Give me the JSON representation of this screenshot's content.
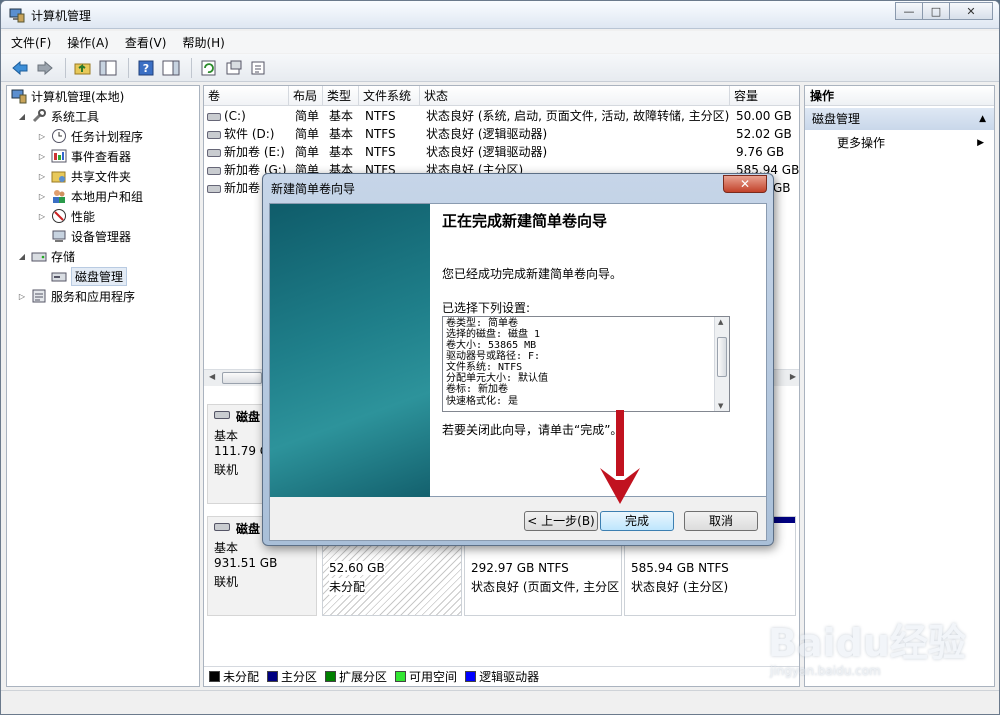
{
  "window": {
    "title": "计算机管理",
    "controls": {
      "minimize": "—",
      "maximize": "□",
      "close": "✕"
    }
  },
  "menu": [
    "文件(F)",
    "操作(A)",
    "查看(V)",
    "帮助(H)"
  ],
  "toolbar": {
    "icons": [
      "back-icon",
      "forward-icon",
      "up-folder-icon",
      "show-hide-tree-icon",
      "help-icon",
      "show-pane-icon",
      "refresh-icon",
      "properties-icon",
      "export-icon"
    ]
  },
  "tree": {
    "root": "计算机管理(本地)",
    "system_tools": "系统工具",
    "task_scheduler": "任务计划程序",
    "event_viewer": "事件查看器",
    "shared_folders": "共享文件夹",
    "local_users": "本地用户和组",
    "performance": "性能",
    "device_manager": "设备管理器",
    "storage": "存储",
    "disk_management": "磁盘管理",
    "services": "服务和应用程序"
  },
  "volumes": {
    "headers": [
      "卷",
      "布局",
      "类型",
      "文件系统",
      "状态",
      "容量"
    ],
    "rows": [
      {
        "name": "(C:)",
        "layout": "简单",
        "type": "基本",
        "fs": "NTFS",
        "status": "状态良好 (系统, 启动, 页面文件, 活动, 故障转储, 主分区)",
        "capacity": "50.00 GB"
      },
      {
        "name": "软件 (D:)",
        "layout": "简单",
        "type": "基本",
        "fs": "NTFS",
        "status": "状态良好 (逻辑驱动器)",
        "capacity": "52.02 GB"
      },
      {
        "name": "新加卷 (E:)",
        "layout": "简单",
        "type": "基本",
        "fs": "NTFS",
        "status": "状态良好 (逻辑驱动器)",
        "capacity": "9.76 GB"
      },
      {
        "name": "新加卷 (G:)",
        "layout": "简单",
        "type": "基本",
        "fs": "NTFS",
        "status": "状态良好 (主分区)",
        "capacity": "585.94 GB"
      },
      {
        "name": "新加卷",
        "layout": "",
        "type": "",
        "fs": "",
        "status": "",
        "capacity": "GB"
      }
    ]
  },
  "disks": [
    {
      "label": "磁盘",
      "type": "基本",
      "size": "111.79 G",
      "state": "联机"
    },
    {
      "label": "磁盘",
      "type": "基本",
      "size": "931.51 GB",
      "state": "联机"
    }
  ],
  "partitions": [
    {
      "size": "52.60 GB",
      "status": "未分配"
    },
    {
      "size": "292.97 GB NTFS",
      "status": "状态良好 (页面文件, 主分区"
    },
    {
      "size": "585.94 GB NTFS",
      "status": "状态良好 (主分区)"
    }
  ],
  "legend": [
    {
      "label": "未分配",
      "color": "#000000"
    },
    {
      "label": "主分区",
      "color": "#000080"
    },
    {
      "label": "扩展分区",
      "color": "#008000"
    },
    {
      "label": "可用空间",
      "color": "#32e632"
    },
    {
      "label": "逻辑驱动器",
      "color": "#0000ff"
    }
  ],
  "actions": {
    "header": "操作",
    "section": "磁盘管理",
    "more": "更多操作"
  },
  "dialog": {
    "title": "新建简单卷向导",
    "close": "✕",
    "heading": "正在完成新建简单卷向导",
    "success": "您已经成功完成新建简单卷向导。",
    "selected_label": "已选择下列设置:",
    "settings": [
      "卷类型: 简单卷",
      "选择的磁盘: 磁盘 1",
      "卷大小: 53865 MB",
      "驱动器号或路径: F:",
      "文件系统: NTFS",
      "分配单元大小: 默认值",
      "卷标: 新加卷",
      "快速格式化: 是"
    ],
    "close_hint": "若要关闭此向导，请单击“完成”。",
    "back": "< 上一步(B)",
    "finish": "完成",
    "cancel": "取消"
  },
  "watermark": {
    "brand": "Baidu经验",
    "url": "jingyan.baidu.com"
  }
}
